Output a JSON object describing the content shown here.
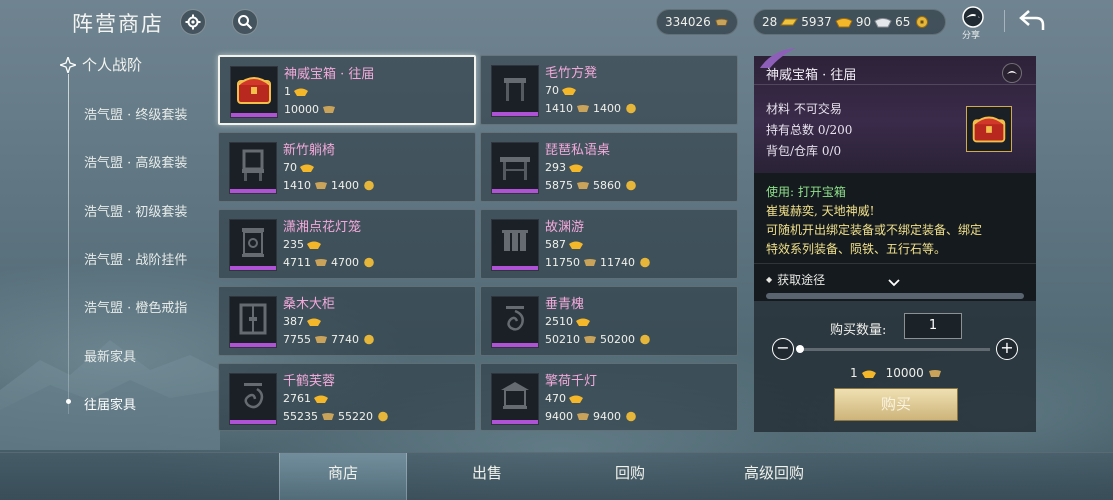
{
  "header": {
    "title": "阵营商店",
    "currencies": [
      {
        "value": "334026",
        "icon": "copper-ingot-icon"
      },
      {
        "value": "28",
        "icon": "gold-bar-icon"
      },
      {
        "value": "5937",
        "icon": "gold-ingot-icon"
      },
      {
        "value": "90",
        "icon": "silver-ingot-icon"
      },
      {
        "value": "65",
        "icon": "coin-icon"
      }
    ],
    "share_label": "分享"
  },
  "sidebar": {
    "heading": "个人战阶",
    "items": [
      {
        "label": "浩气盟 · 终级套装"
      },
      {
        "label": "浩气盟 · 高级套装"
      },
      {
        "label": "浩气盟 · 初级套装"
      },
      {
        "label": "浩气盟 · 战阶挂件"
      },
      {
        "label": "浩气盟 · 橙色戒指"
      },
      {
        "label": "最新家具"
      },
      {
        "label": "往届家具"
      }
    ]
  },
  "items": [
    {
      "name": "神威宝箱 · 往届",
      "line1": "1",
      "line2a": "10000",
      "line2b": "",
      "selected": true
    },
    {
      "name": "毛竹方凳",
      "line1": "70",
      "line2a": "1410",
      "line2b": "1400",
      "selected": false
    },
    {
      "name": "新竹躺椅",
      "line1": "70",
      "line2a": "1410",
      "line2b": "1400",
      "selected": false
    },
    {
      "name": "琵琶私语桌",
      "line1": "293",
      "line2a": "5875",
      "line2b": "5860",
      "selected": false
    },
    {
      "name": "潇湘点花灯笼",
      "line1": "235",
      "line2a": "4711",
      "line2b": "4700",
      "selected": false
    },
    {
      "name": "故渊游",
      "line1": "587",
      "line2a": "11750",
      "line2b": "11740",
      "selected": false
    },
    {
      "name": "桑木大柜",
      "line1": "387",
      "line2a": "7755",
      "line2b": "7740",
      "selected": false
    },
    {
      "name": "垂青槐",
      "line1": "2510",
      "line2a": "50210",
      "line2b": "50200",
      "selected": false
    },
    {
      "name": "千鹤芙蓉",
      "line1": "2761",
      "line2a": "55235",
      "line2b": "55220",
      "selected": false
    },
    {
      "name": "擎荷千灯",
      "line1": "470",
      "line2a": "9400",
      "line2b": "9400",
      "selected": false
    }
  ],
  "detail": {
    "title": "神威宝箱 · 往届",
    "material": "材料  不可交易",
    "owned": "持有总数  0/200",
    "bag": "背包/仓库  0/0",
    "use": "使用: 打开宝箱",
    "flavor": "崔嵬赫奕, 天地神威!",
    "desc1": "可随机开出绑定装备或不绑定装备、绑定",
    "desc2": "特效系列装备、陨铁、五行石等。",
    "acquire": "获取途径",
    "qty_label": "购买数量:",
    "qty_value": "1",
    "price_a": "1",
    "price_b": "10000",
    "buy_label": "购买",
    "colors": {
      "name": "#f2a9d9",
      "use_green": "#8fe08a",
      "desc_yellow": "#f1e08a"
    }
  },
  "tabs": [
    {
      "label": "商店",
      "active": true
    },
    {
      "label": "出售",
      "active": false
    },
    {
      "label": "回购",
      "active": false
    },
    {
      "label": "高级回购",
      "active": false
    }
  ]
}
